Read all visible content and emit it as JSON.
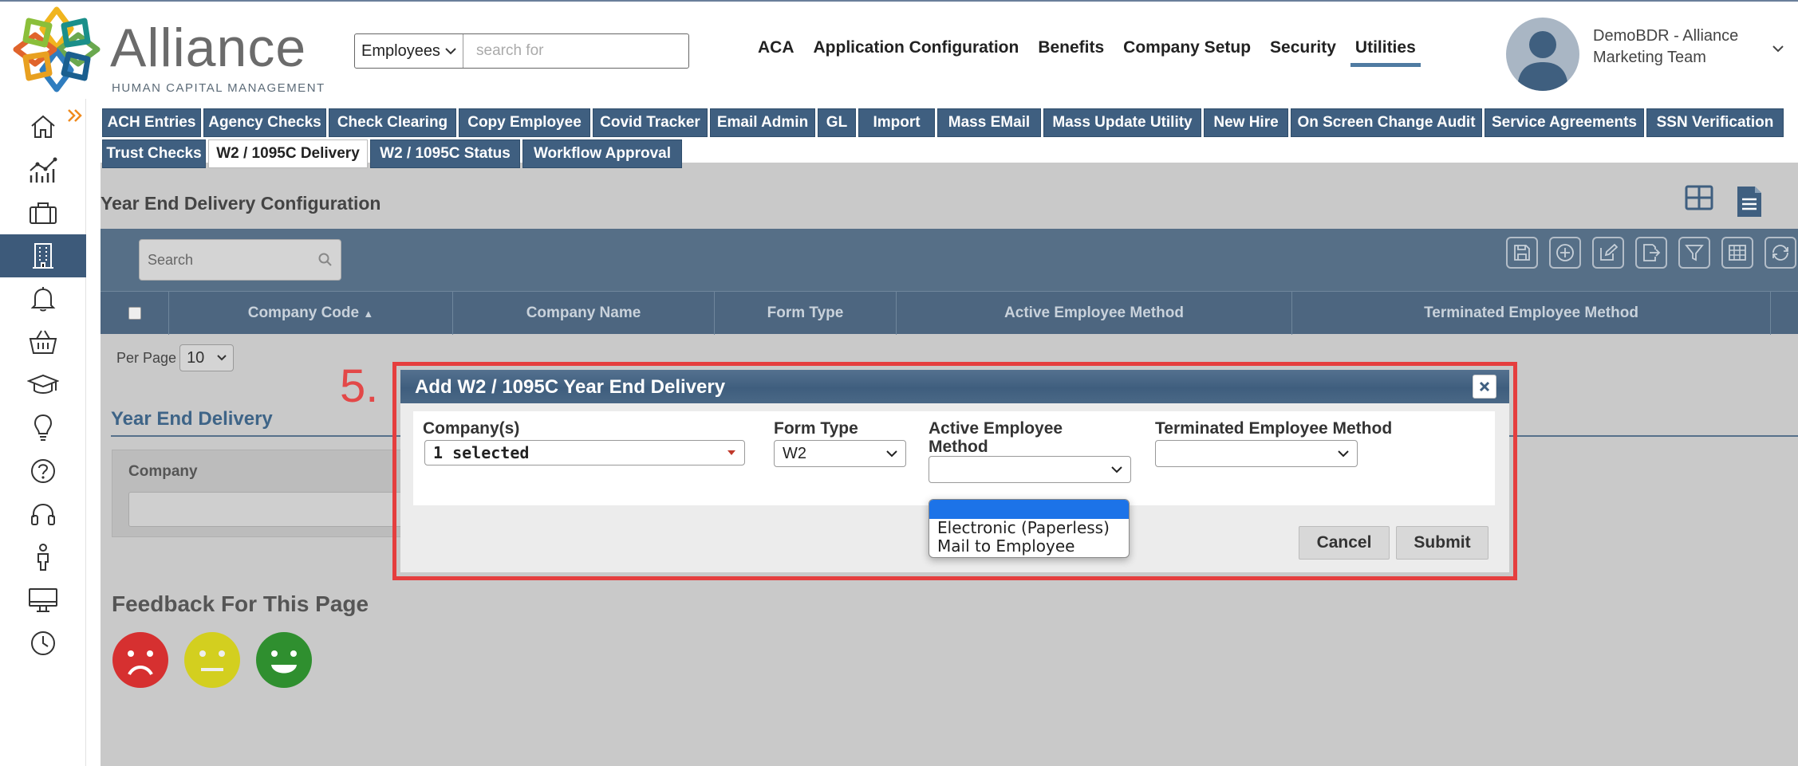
{
  "header": {
    "logo_name": "Alliance",
    "logo_subtitle": "HUMAN CAPITAL MANAGEMENT",
    "search_scope": "Employees",
    "search_placeholder": "search for",
    "nav": [
      "ACA",
      "Application Configuration",
      "Benefits",
      "Company Setup",
      "Security",
      "Utilities"
    ],
    "active_nav": "Utilities",
    "user_name": "DemoBDR - Alliance Marketing Team"
  },
  "sidebar": {
    "icons": [
      "home-icon",
      "chart-icon",
      "briefcase-icon",
      "building-icon",
      "bell-icon",
      "basket-icon",
      "graduation-cap-icon",
      "lightbulb-icon",
      "help-icon",
      "headset-icon",
      "person-icon",
      "monitor-icon",
      "clock-icon"
    ],
    "active_index": 3
  },
  "tabs": {
    "row1": [
      "ACH Entries",
      "Agency Checks",
      "Check Clearing",
      "Copy Employee",
      "Covid Tracker",
      "Email Admin",
      "GL",
      "Import",
      "Mass EMail",
      "Mass Update Utility",
      "New Hire",
      "On Screen Change Audit",
      "Service Agreements",
      "SSN Verification"
    ],
    "row2": [
      "Trust Checks",
      "W2 / 1095C Delivery",
      "W2 / 1095C Status",
      "Workflow Approval"
    ],
    "active": "W2 / 1095C Delivery"
  },
  "page": {
    "title": "Year End Delivery Configuration",
    "grid_search_placeholder": "Search",
    "columns": [
      "Company Code",
      "Company Name",
      "Form Type",
      "Active Employee Method",
      "Terminated Employee Method"
    ],
    "sort_indicator": "▲",
    "per_page_label": "Per Page",
    "per_page_value": "10",
    "section_title": "Year End Delivery",
    "filter_label": "Company",
    "feedback_title": "Feedback For This Page"
  },
  "annotation": {
    "step": "5."
  },
  "modal": {
    "title": "Add W2 / 1095C Year End Delivery",
    "close": "×",
    "companies_label": "Company(s)",
    "companies_value": "1 selected",
    "form_type_label": "Form Type",
    "form_type_value": "W2",
    "active_method_label_1": "Active Employee",
    "active_method_label_2": "Method",
    "active_method_value": "",
    "terminated_method_label": "Terminated Employee Method",
    "terminated_method_value": "",
    "dropdown_options": [
      "Electronic (Paperless)",
      "Mail to Employee"
    ],
    "cancel_label": "Cancel",
    "submit_label": "Submit"
  },
  "colors": {
    "accent": "#3f5f80",
    "highlight": "#e53e3e",
    "dropdown_selected": "#1c73e8"
  }
}
